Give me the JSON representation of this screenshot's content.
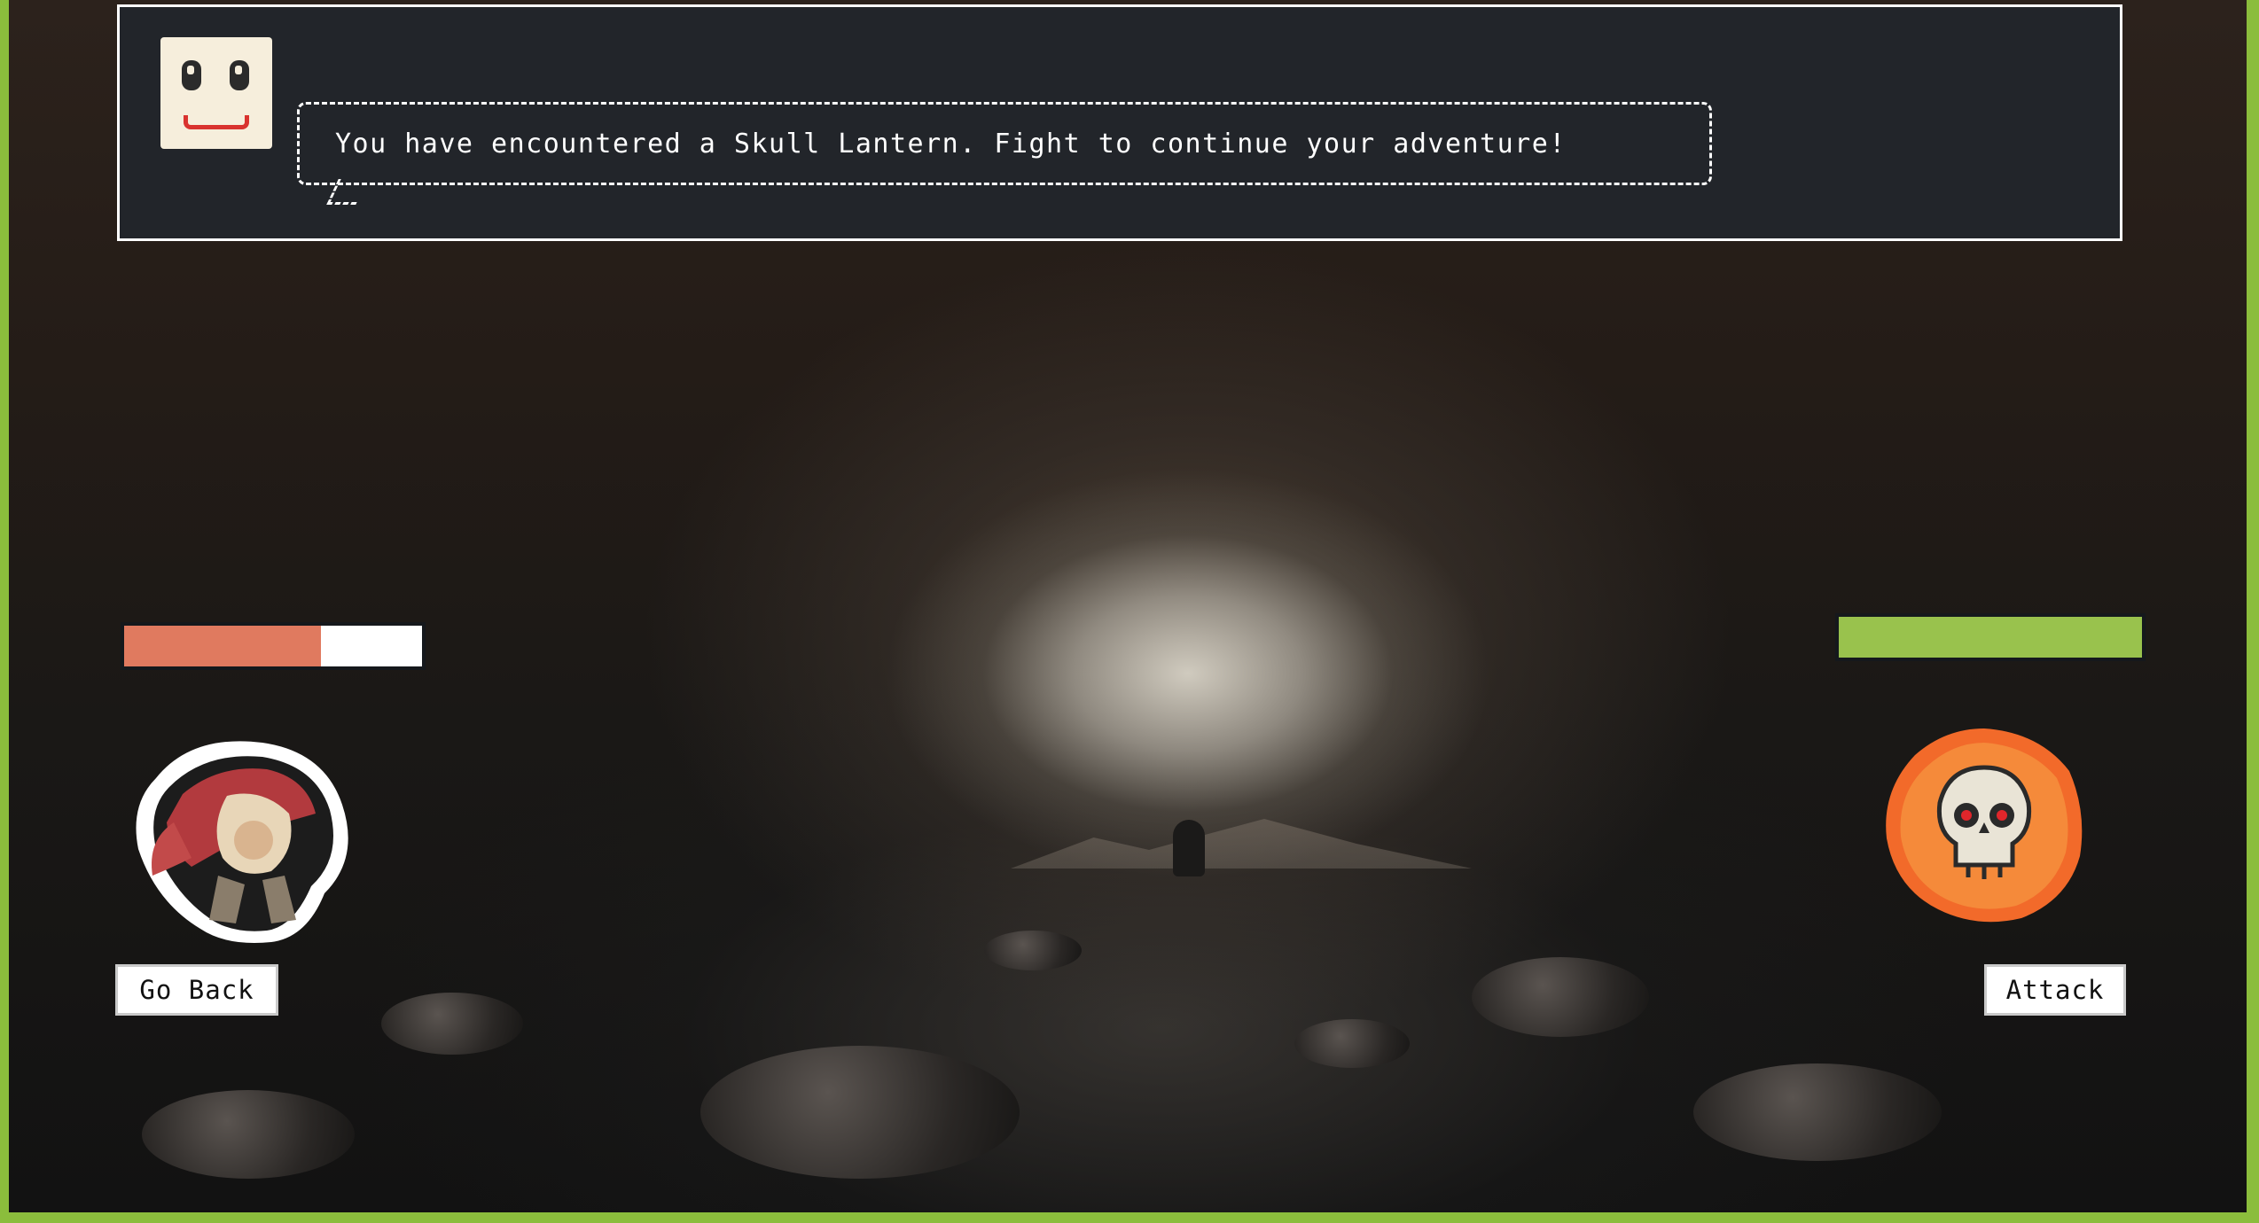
{
  "dialog": {
    "message": "You have encountered a Skull Lantern. Fight to continue your adventure!"
  },
  "player": {
    "health_fraction": 0.66,
    "health_color": "#e07a5f",
    "health_empty_color": "#ffffff"
  },
  "enemy": {
    "health_fraction": 1.0,
    "health_color": "#99c24d",
    "glow_color": "#f26a2a"
  },
  "actions": {
    "go_back_label": "Go Back",
    "attack_label": "Attack"
  },
  "colors": {
    "dialog_bg": "#22252a",
    "page_border": "#8bbd3c"
  }
}
